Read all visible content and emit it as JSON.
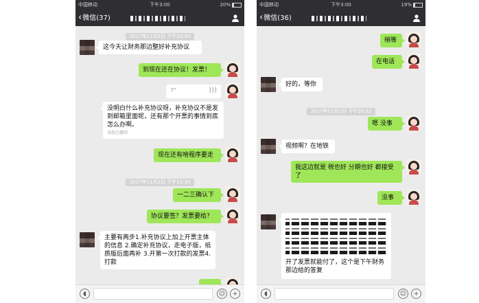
{
  "phones": [
    {
      "status": {
        "carrier": "中国移动",
        "wifi": "wifi-icon",
        "time": "下午3:00",
        "battery": "20%"
      },
      "nav": {
        "back_label": "微信(37)",
        "title": ""
      },
      "messages": [
        {
          "kind": "timestamp",
          "text": "2017年11月2日 下午10:50"
        },
        {
          "kind": "left",
          "text": "这今天让财务那边整好补充协议"
        },
        {
          "kind": "right",
          "text": "到现在还在协议！发票！"
        },
        {
          "kind": "voice",
          "text": "7\""
        },
        {
          "kind": "left",
          "text": "没明白什么补充协议呀，补充协议不是发到邮箱里面呢，还有那个开票的事情到底怎么办啊。",
          "note": "消息已撤回"
        },
        {
          "kind": "right",
          "text": "现在还有啥程序要走"
        },
        {
          "kind": "timestamp",
          "text": "2017年11月2日 下午12:30"
        },
        {
          "kind": "right",
          "text": "一二三确认下"
        },
        {
          "kind": "right",
          "text": "协议要签？发票要给？"
        },
        {
          "kind": "left",
          "text": "主要有两步1.补充协议上加上开票主体的信息 2.确定补充协议，走电子版，纸质版后面再补 3.开第一次打款的发票4.打款"
        }
      ]
    },
    {
      "status": {
        "carrier": "中国移动",
        "wifi": "wifi-icon",
        "time": "下午3:00",
        "battery": "19%"
      },
      "nav": {
        "back_label": "微信(36)",
        "title": ""
      },
      "messages": [
        {
          "kind": "right",
          "text": "稍等"
        },
        {
          "kind": "right",
          "text": "在电话"
        },
        {
          "kind": "left",
          "text": "好的，等你"
        },
        {
          "kind": "timestamp",
          "text": "2017年11月2日 下午10:52"
        },
        {
          "kind": "right",
          "text": "嗯 没事"
        },
        {
          "kind": "left",
          "text": "视频啊？在地铁"
        },
        {
          "kind": "right",
          "text": "我这边就是  税也好 分期也好  都接受了"
        },
        {
          "kind": "right",
          "text": "没事"
        },
        {
          "kind": "left",
          "text": "开了发票就能付了，这个是下午财务那边给的答复"
        }
      ]
    }
  ]
}
